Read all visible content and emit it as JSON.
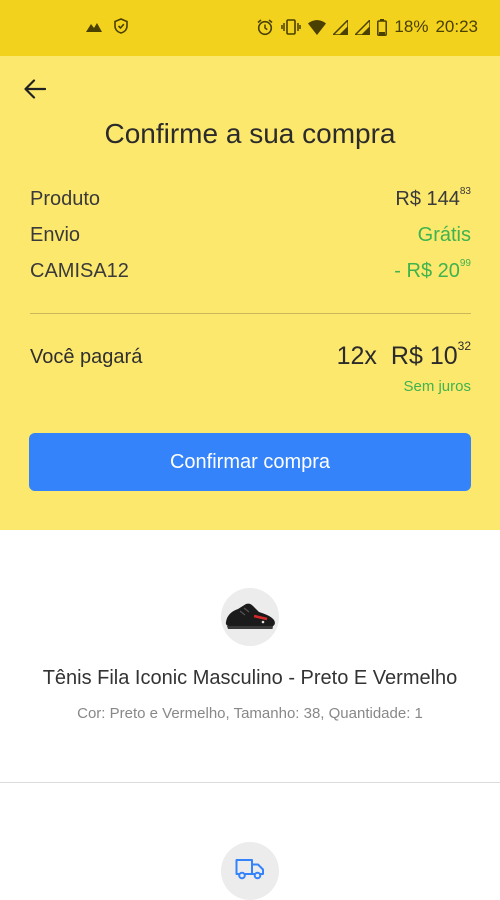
{
  "status_bar": {
    "battery": "18%",
    "time": "20:23",
    "icons": [
      "mountain-icon",
      "shield-icon",
      "alarm-icon",
      "vibrate-icon",
      "wifi-icon",
      "signal-icon",
      "signal-icon",
      "battery-icon"
    ]
  },
  "header": {
    "back_icon": "arrow-left-icon",
    "title": "Confirme a sua compra"
  },
  "summary": {
    "rows": [
      {
        "label": "Produto",
        "amount": "R$ 144",
        "cents": "83"
      },
      {
        "label": "Envio",
        "amount": "Grátis",
        "cents": ""
      },
      {
        "label": "CAMISA12",
        "amount": "- R$ 20",
        "cents": "99"
      }
    ]
  },
  "payment": {
    "label": "Você pagará",
    "installments": "12x",
    "amount": "R$ 10",
    "cents": "32",
    "note": "Sem juros"
  },
  "confirm_label": "Confirmar compra",
  "product": {
    "name": "Tênis Fila Iconic Masculino - Preto E Vermelho",
    "details": "Cor: Preto e Vermelho, Tamanho: 38, Quantidade: 1",
    "image_icon": "sneaker-icon"
  },
  "shipping": {
    "icon": "truck-icon"
  },
  "colors": {
    "status_bar": "#f3d21e",
    "panel": "#fde86e",
    "accent_blue": "#3483fa",
    "green": "#3eb34e"
  }
}
